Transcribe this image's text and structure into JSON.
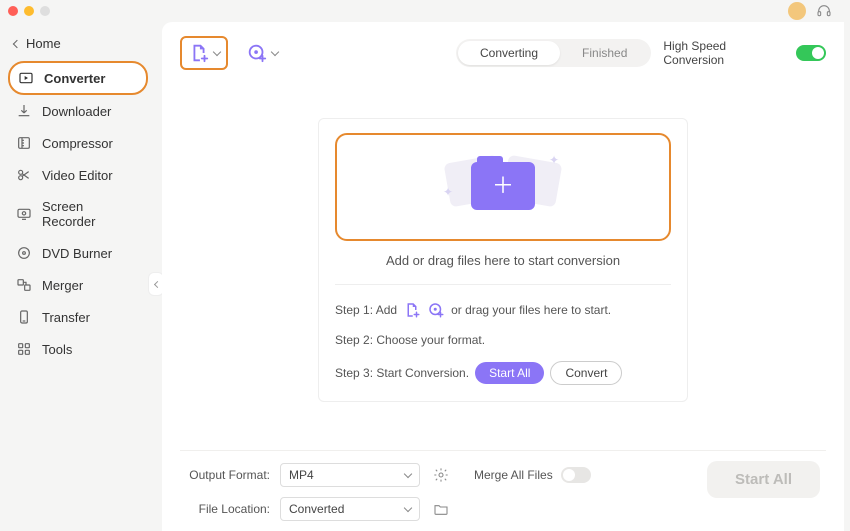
{
  "colors": {
    "accent": "#e6892e",
    "primary": "#8b75f6",
    "toggle_on": "#34c759"
  },
  "titlebar": {},
  "sidebar": {
    "home": "Home",
    "items": [
      {
        "label": "Converter",
        "icon": "converter-icon",
        "active": true
      },
      {
        "label": "Downloader",
        "icon": "downloader-icon",
        "active": false
      },
      {
        "label": "Compressor",
        "icon": "compressor-icon",
        "active": false
      },
      {
        "label": "Video Editor",
        "icon": "video-editor-icon",
        "active": false
      },
      {
        "label": "Screen Recorder",
        "icon": "screen-recorder-icon",
        "active": false
      },
      {
        "label": "DVD Burner",
        "icon": "dvd-burner-icon",
        "active": false
      },
      {
        "label": "Merger",
        "icon": "merger-icon",
        "active": false
      },
      {
        "label": "Transfer",
        "icon": "transfer-icon",
        "active": false
      },
      {
        "label": "Tools",
        "icon": "tools-icon",
        "active": false
      }
    ]
  },
  "toolbar": {
    "tabs": {
      "converting": "Converting",
      "finished": "Finished",
      "active": "converting"
    },
    "hsc_label": "High Speed Conversion",
    "hsc_on": true
  },
  "dropzone": {
    "hint": "Add or drag files here to start conversion",
    "step1_prefix": "Step 1: Add",
    "step1_suffix": "or drag your files here to start.",
    "step2": "Step 2: Choose your format.",
    "step3_prefix": "Step 3: Start Conversion.",
    "start_all_label": "Start  All",
    "convert_label": "Convert"
  },
  "footer": {
    "output_format_label": "Output Format:",
    "output_format_value": "MP4",
    "file_location_label": "File Location:",
    "file_location_value": "Converted",
    "merge_label": "Merge All Files",
    "merge_on": false,
    "start_all": "Start All"
  }
}
